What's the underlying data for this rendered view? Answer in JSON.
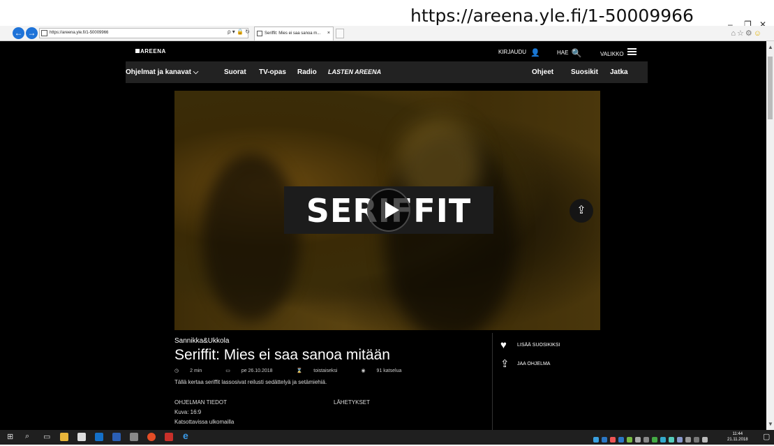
{
  "overlay_url": "https://areena.yle.fi/1-50009966",
  "browser": {
    "address": "https://areena.yle.fi/1-50009966",
    "address_tools": "ρ ▾ 🔒 ↻",
    "tab_title": "Seriffit: Mies ei saa sanoa m...",
    "tab_close": "×"
  },
  "window_controls": {
    "minimize": "–",
    "maximize": "❐",
    "close": "✕"
  },
  "site": {
    "logo": "AREENA",
    "login": "KIRJAUDU",
    "search": "HAE",
    "menu": "VALIKKO",
    "nav": {
      "programs": "Ohjelmat ja kanavat ⌵",
      "live": "Suorat",
      "tv_guide": "TV-opas",
      "radio": "Radio",
      "kids": "LASTEN AREENA",
      "help": "Ohjeet",
      "favorites": "Suosikit",
      "continue": "Jatka"
    }
  },
  "video": {
    "title_card": "SERIFFIT",
    "player_state": "paused"
  },
  "program": {
    "producer": "Sannikka&Ukkola",
    "title": "Seriffit: Mies ei saa sanoa mitään",
    "duration": "2 min",
    "date": "pe 26.10.2018",
    "availability": "toistaiseksi",
    "views": "91 katselua",
    "description": "Tällä kertaa seriffit lassosivat reilusti sedättelyä ja setämiehiä.",
    "details_heading": "OHJELMAN TIEDOT",
    "broadcasts_heading": "LÄHETYKSET",
    "aspect": "Kuva: 16:9",
    "abroad": "Katsottavissa ulkomailla"
  },
  "actions": {
    "add_favorite": "LISÄÄ SUOSIKIKSI",
    "share": "JAA OHJELMA"
  },
  "taskbar": {
    "time": "11:44",
    "date": "21.11.2018"
  },
  "colors": {
    "page_bg": "#000000",
    "navbar_bg": "#222222",
    "taskbar_bg": "#1f1f1f",
    "ie_blue": "#1e73d8"
  }
}
